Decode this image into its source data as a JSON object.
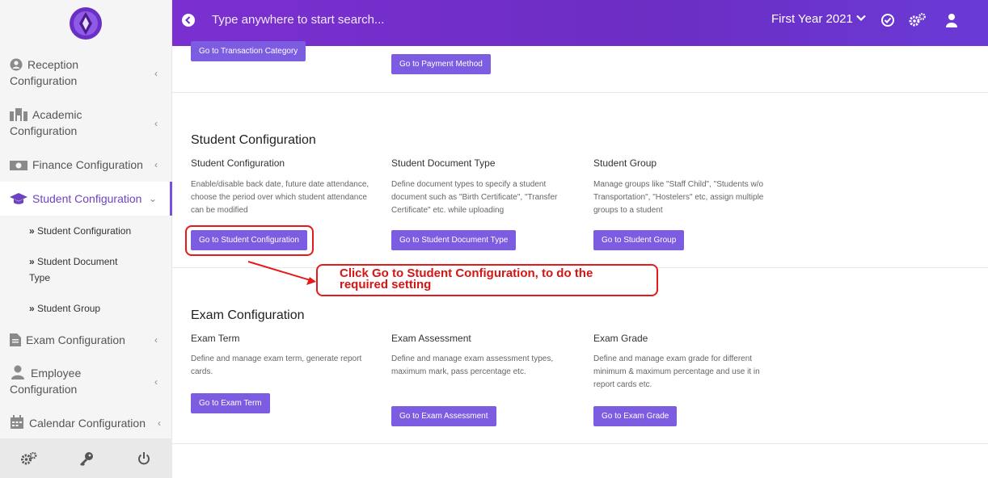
{
  "sidebar": {
    "items": [
      {
        "label1": "Reception",
        "label2": "Configuration"
      },
      {
        "label1": "Academic",
        "label2": "Configuration"
      },
      {
        "label": "Finance Configuration"
      },
      {
        "label": "Student Configuration"
      },
      {
        "label": "Exam Configuration"
      },
      {
        "label1": "Employee",
        "label2": "Configuration"
      },
      {
        "label": "Calendar Configuration"
      }
    ],
    "subitems": [
      {
        "label": "Student Configuration"
      },
      {
        "label1": "Student Document",
        "label2": "Type"
      },
      {
        "label": "Student Group"
      }
    ]
  },
  "topbar": {
    "search_placeholder": "Type anywhere to start search...",
    "year": "First Year 2021"
  },
  "top_section": {
    "btn1": "Go to Transaction Category",
    "btn2": "Go to Payment Method"
  },
  "student_section": {
    "title": "Student Configuration",
    "cards": [
      {
        "title": "Student Configuration",
        "desc": "Enable/disable back date, future date attendance, choose the period over which student attendance can be modified",
        "button": "Go to Student Configuration"
      },
      {
        "title": "Student Document Type",
        "desc": "Define document types to specify a student document such as \"Birth Certificate\", \"Transfer Certificate\" etc. while uploading",
        "button": "Go to Student Document Type"
      },
      {
        "title": "Student Group",
        "desc": "Manage groups like \"Staff Child\", \"Students w/o Transportation\", \"Hostelers\" etc, assign multiple groups to a student",
        "button": "Go to Student Group"
      }
    ]
  },
  "exam_section": {
    "title": "Exam Configuration",
    "cards": [
      {
        "title": "Exam Term",
        "desc": "Define and manage exam term, generate report cards.",
        "button": "Go to Exam Term"
      },
      {
        "title": "Exam Assessment",
        "desc": "Define and manage exam assessment types, maximum mark, pass percentage etc.",
        "button": "Go to Exam Assessment"
      },
      {
        "title": "Exam Grade",
        "desc": "Define and manage exam grade for different minimum & maximum percentage and use it in report cards etc.",
        "button": "Go to Exam Grade"
      }
    ]
  },
  "annotation": {
    "line1": "Click Go to Student Configuration, to do the",
    "line2": "required setting"
  },
  "colors": {
    "accent": "#7c5ce0",
    "topbar": "#6c2ec4",
    "annotation": "#e51b1b"
  }
}
